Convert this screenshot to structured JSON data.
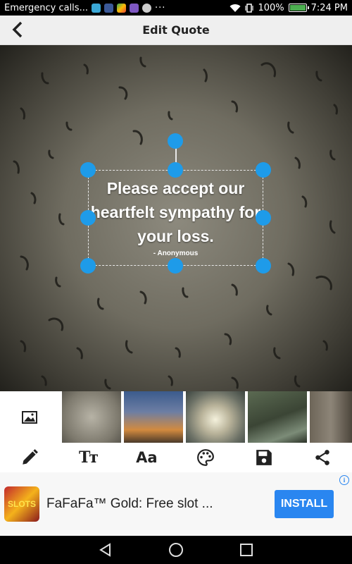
{
  "status_bar": {
    "notification": "Emergency calls...",
    "notif_icons": [
      "messenger-icon",
      "facebook-icon",
      "google-play-icon",
      "image-icon",
      "circle-icon"
    ],
    "more": "···",
    "battery_percent": "100%",
    "battery_level": 1.0,
    "time": "7:24 PM"
  },
  "app_bar": {
    "title": "Edit Quote",
    "back_icon": "chevron-left-icon"
  },
  "quote": {
    "text": "Please accept our heartfelt sympathy for your loss.",
    "author": "- Anonymous"
  },
  "tools": [
    {
      "name": "edit-tool",
      "icon": "pencil-icon"
    },
    {
      "name": "text-size-tool",
      "icon": "text-size-icon",
      "label": "Tт"
    },
    {
      "name": "font-tool",
      "icon": "font-icon",
      "label": "Aa"
    },
    {
      "name": "color-tool",
      "icon": "palette-icon"
    },
    {
      "name": "save-tool",
      "icon": "floppy-icon"
    },
    {
      "name": "share-tool",
      "icon": "share-icon"
    }
  ],
  "ad": {
    "logo_text": "SLOTS",
    "title": "FaFaFa™ Gold: Free slot ...",
    "button": "INSTALL",
    "info": "i"
  },
  "colors": {
    "accent": "#1e9be9",
    "install_button": "#2a86f0"
  }
}
